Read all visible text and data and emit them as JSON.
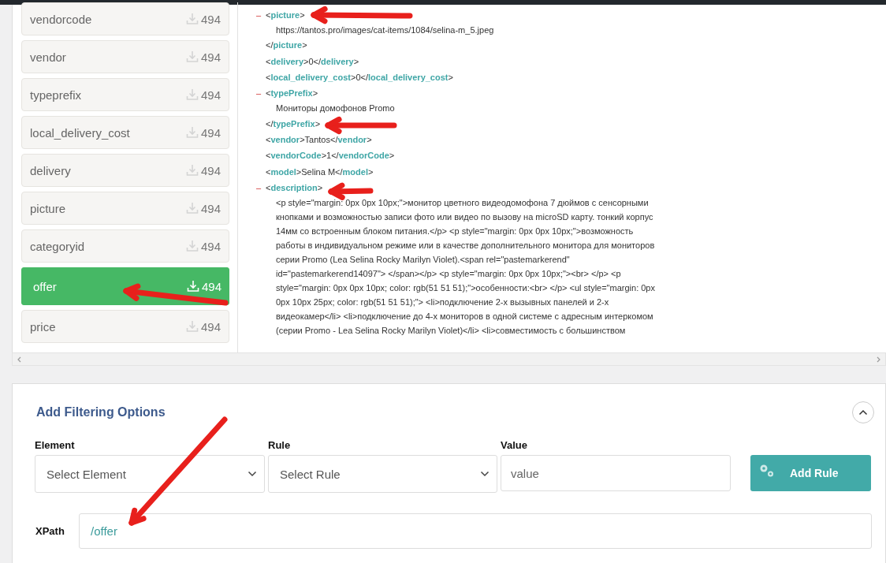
{
  "sidebar": {
    "items": [
      {
        "label": "vendorcode",
        "count": "494",
        "selected": false
      },
      {
        "label": "vendor",
        "count": "494",
        "selected": false
      },
      {
        "label": "typeprefix",
        "count": "494",
        "selected": false
      },
      {
        "label": "local_delivery_cost",
        "count": "494",
        "selected": false
      },
      {
        "label": "delivery",
        "count": "494",
        "selected": false
      },
      {
        "label": "picture",
        "count": "494",
        "selected": false
      },
      {
        "label": "categoryid",
        "count": "494",
        "selected": false
      },
      {
        "label": "offer",
        "count": "494",
        "selected": true
      },
      {
        "label": "price",
        "count": "494",
        "selected": false
      }
    ]
  },
  "xml_preview": {
    "nodes": [
      {
        "toggle": "–",
        "open": "<**picture**>",
        "children": [
          {
            "text": "https://tantos.pro/images/cat-items/1084/selina-m_5.jpeg"
          }
        ],
        "close": "</**picture**>"
      },
      {
        "text": "<**delivery**>0</**delivery**>"
      },
      {
        "text": "<**local_delivery_cost**>0</**local_delivery_cost**>"
      },
      {
        "toggle": "–",
        "open": "<**typePrefix**>",
        "children": [
          {
            "text": "Мониторы домофонов Promo"
          }
        ],
        "close": "</**typePrefix**>"
      },
      {
        "text": "<**vendor**>Tantos</**vendor**>"
      },
      {
        "text": "<**vendorCode**>1</**vendorCode**>"
      },
      {
        "text": "<**model**>Selina M</**model**>"
      },
      {
        "toggle": "–",
        "open": "<**description**>",
        "children": [
          {
            "text": "<p style=\"margin: 0px 0px 10px;\">монитор цветного видеодомофона 7 дюймов с сенсорными кнопками и возможностью записи фото или видео по вызову на microSD карту. тонкий корпус 14мм со встроенным блоком питания.</p> <p style=\"margin: 0px 0px 10px;\">возможность работы в индивидуальном режиме или в качестве дополнительного монитора для мониторов серии Promo (Lea Selina Rocky Marilyn Violet).<span rel=\"pastemarkerend\" id=\"pastemarkerend14097\"> </span></p> <p style=\"margin: 0px 0px 10px;\"><br> </p> <p style=\"margin: 0px 0px 10px; color: rgb(51 51 51);\">особенности:<br> </p> <ul style=\"margin: 0px 0px 10px 25px; color: rgb(51 51 51);\"> <li>подключение 2-х вызывных панелей и 2-х видеокамер</li> <li>подключение до 4-х мониторов в одной системе с адресным интеркомом (серии Promo - Lea Selina Rocky Marilyn Violet)</li> <li>совместимость с большинством"
          }
        ]
      }
    ]
  },
  "filter": {
    "title": "Add Filtering Options",
    "element": {
      "label": "Element",
      "placeholder": "Select Element"
    },
    "rule": {
      "label": "Rule",
      "placeholder": "Select Rule"
    },
    "value": {
      "label": "Value",
      "placeholder": "value"
    },
    "add_button": "Add Rule",
    "xpath": {
      "label": "XPath",
      "value": "/offer"
    }
  }
}
